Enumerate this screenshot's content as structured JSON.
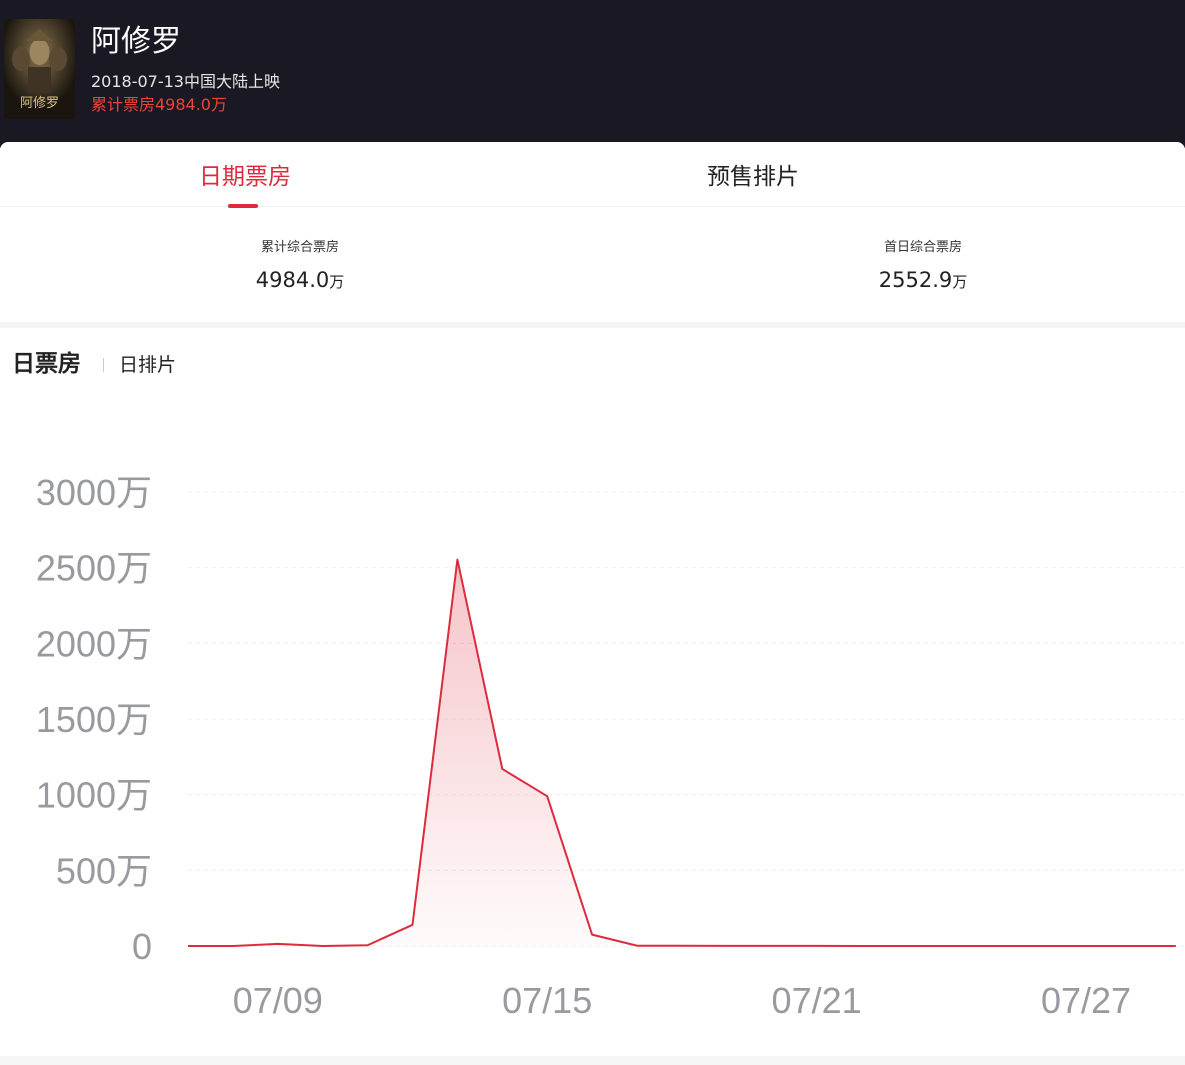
{
  "movie": {
    "title": "阿修罗",
    "release": "2018-07-13中国大陆上映",
    "cumulative_line": "累计票房4984.0万",
    "poster_icon": "movie-poster-image"
  },
  "tabs": [
    {
      "label": "日期票房",
      "active": true
    },
    {
      "label": "预售排片",
      "active": false
    }
  ],
  "stats": {
    "total": {
      "label": "累计综合票房",
      "value": "4984.0",
      "unit": "万"
    },
    "first_day": {
      "label": "首日综合票房",
      "value": "2552.9",
      "unit": "万"
    }
  },
  "chart_tabs": {
    "main": "日票房",
    "sub": "日排片"
  },
  "colors": {
    "accent": "#dd2b3e",
    "header_bg": "#1a1822",
    "cumulative": "#ef4238"
  },
  "chart_data": {
    "type": "area",
    "x": [
      "07/07",
      "07/08",
      "07/09",
      "07/10",
      "07/11",
      "07/12",
      "07/13",
      "07/14",
      "07/15",
      "07/16",
      "07/17",
      "07/18",
      "07/19",
      "07/20",
      "07/21",
      "07/22",
      "07/23",
      "07/24",
      "07/25",
      "07/26",
      "07/27",
      "07/28",
      "07/29"
    ],
    "values": [
      0,
      0,
      14,
      0,
      5,
      140,
      2553,
      1170,
      990,
      75,
      2,
      2,
      1,
      1,
      1,
      0,
      0,
      0,
      0,
      0,
      0,
      0,
      0
    ],
    "x_tick_labels": [
      "07/09",
      "07/15",
      "07/21",
      "07/27"
    ],
    "y_ticks": [
      0,
      500,
      1000,
      1500,
      2000,
      2500,
      3000
    ],
    "y_tick_labels": [
      "0",
      "500万",
      "1000万",
      "1500万",
      "2000万",
      "2500万",
      "3000万"
    ],
    "ylim": [
      0,
      3000
    ],
    "grid": true,
    "line_color": "#dd2b3e"
  }
}
